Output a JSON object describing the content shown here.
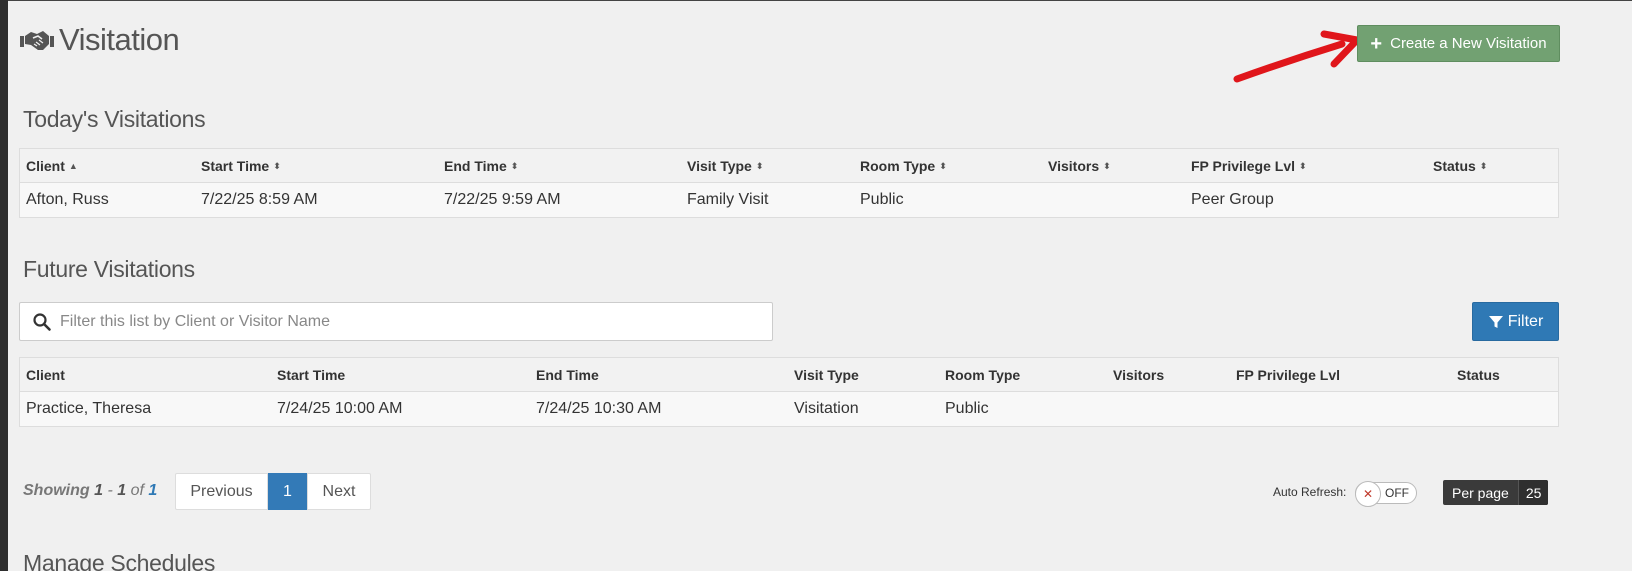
{
  "page": {
    "title": "Visitation",
    "create_button": "Create a New Visitation"
  },
  "today": {
    "title": "Today's Visitations",
    "columns": [
      "Client",
      "Start Time",
      "End Time",
      "Visit Type",
      "Room Type",
      "Visitors",
      "FP Privilege Lvl",
      "Status"
    ],
    "rows": [
      [
        "Afton, Russ",
        "7/22/25 8:59 AM",
        "7/22/25 9:59 AM",
        "Family Visit",
        "Public",
        "",
        "Peer Group",
        ""
      ]
    ]
  },
  "future": {
    "title": "Future Visitations",
    "search_placeholder": "Filter this list by Client or Visitor Name",
    "filter_button": "Filter",
    "columns": [
      "Client",
      "Start Time",
      "End Time",
      "Visit Type",
      "Room Type",
      "Visitors",
      "FP Privilege Lvl",
      "Status"
    ],
    "rows": [
      [
        "Practice, Theresa",
        "7/24/25 10:00 AM",
        "7/24/25 10:30 AM",
        "Visitation",
        "Public",
        "",
        "",
        ""
      ]
    ]
  },
  "pagination": {
    "showing_label": "Showing",
    "range_start": "1",
    "range_sep": " - ",
    "range_end": "1",
    "of_label": "of",
    "total": "1",
    "previous": "Previous",
    "current_page": "1",
    "next": "Next"
  },
  "auto_refresh": {
    "label": "Auto Refresh:",
    "state": "OFF"
  },
  "per_page": {
    "label": "Per page",
    "value": "25"
  },
  "manage": {
    "title": "Manage Schedules"
  },
  "colors": {
    "create_button": "#72a172",
    "filter_button": "#2f79b5",
    "active_page": "#337ab7",
    "annotation_arrow": "#e0161b"
  },
  "icons": {
    "header": "handshake-icon",
    "search": "search-icon",
    "filter": "funnel-icon",
    "create": "plus-icon",
    "toggle": "x-icon"
  }
}
